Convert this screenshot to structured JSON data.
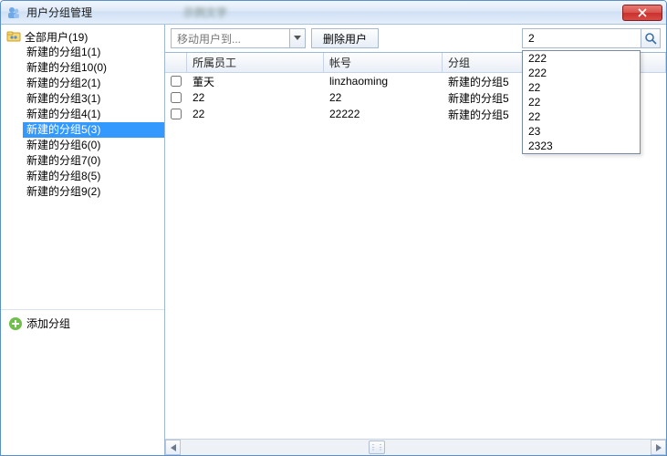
{
  "window": {
    "title": "用户分组管理",
    "blurred_text": "示例文字"
  },
  "sidebar": {
    "root_label": "全部用户(19)",
    "items": [
      {
        "label": "新建的分组1(1)"
      },
      {
        "label": "新建的分组10(0)"
      },
      {
        "label": "新建的分组2(1)"
      },
      {
        "label": "新建的分组3(1)"
      },
      {
        "label": "新建的分组4(1)"
      },
      {
        "label": "新建的分组5(3)",
        "selected": true
      },
      {
        "label": "新建的分组6(0)"
      },
      {
        "label": "新建的分组7(0)"
      },
      {
        "label": "新建的分组8(5)"
      },
      {
        "label": "新建的分组9(2)"
      }
    ],
    "add_group_label": "添加分组"
  },
  "toolbar": {
    "move_user_placeholder": "移动用户到...",
    "delete_user_label": "删除用户",
    "search_value": "2"
  },
  "table": {
    "headers": {
      "col1": "所属员工",
      "col2": "帐号",
      "col3": "分组"
    },
    "rows": [
      {
        "employee": "董天",
        "account": "linzhaoming",
        "group": "新建的分组5"
      },
      {
        "employee": "22",
        "account": "22",
        "group": "新建的分组5"
      },
      {
        "employee": "22",
        "account": "22222",
        "group": "新建的分组5"
      }
    ]
  },
  "dropdown": {
    "options": [
      "222",
      "222",
      "22",
      "22",
      "22",
      "23",
      "2323"
    ]
  },
  "icons": {
    "app": "user-group-icon",
    "close": "close-icon",
    "folder": "folder-users-icon",
    "plus": "plus-icon",
    "chevron_down": "chevron-down-icon",
    "search": "search-icon",
    "arrow_left": "arrow-left-icon",
    "arrow_right": "arrow-right-icon"
  }
}
